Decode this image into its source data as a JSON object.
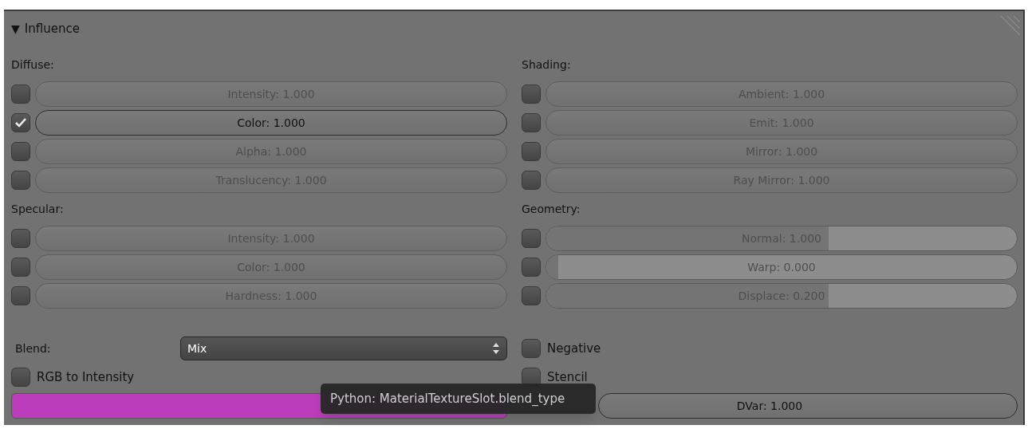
{
  "panel": {
    "toggle": "▼",
    "title": "Influence"
  },
  "left_groups": [
    {
      "label": "Diffuse:",
      "rows": [
        {
          "kind": "field",
          "label": "Intensity: 1.000",
          "checked": false
        },
        {
          "kind": "field",
          "label": "Color: 1.000",
          "checked": true
        },
        {
          "kind": "field",
          "label": "Alpha: 1.000",
          "checked": false
        },
        {
          "kind": "field",
          "label": "Translucency: 1.000",
          "checked": false
        }
      ]
    },
    {
      "label": "Specular:",
      "rows": [
        {
          "kind": "field",
          "label": "Intensity: 1.000",
          "checked": false
        },
        {
          "kind": "field",
          "label": "Color: 1.000",
          "checked": false
        },
        {
          "kind": "field",
          "label": "Hardness: 1.000",
          "checked": false
        }
      ]
    }
  ],
  "right_groups": [
    {
      "label": "Shading:",
      "rows": [
        {
          "kind": "field",
          "label": "Ambient: 1.000",
          "checked": false
        },
        {
          "kind": "field",
          "label": "Emit: 1.000",
          "checked": false
        },
        {
          "kind": "field",
          "label": "Mirror: 1.000",
          "checked": false
        },
        {
          "kind": "field",
          "label": "Ray Mirror: 1.000",
          "checked": false
        }
      ]
    },
    {
      "label": "Geometry:",
      "rows": [
        {
          "kind": "slider",
          "label": "Normal: 1.000",
          "checked": false,
          "level": 0.6
        },
        {
          "kind": "slider",
          "label": "Warp: 0.000",
          "checked": false,
          "level": 0
        },
        {
          "kind": "slider",
          "label": "Displace: 0.200",
          "checked": false,
          "level": 0.6
        }
      ]
    }
  ],
  "blend": {
    "label": "Blend:",
    "value": "Mix"
  },
  "left_options": [
    {
      "label": "RGB to Intensity",
      "checked": false
    }
  ],
  "right_options": [
    {
      "label": "Negative",
      "checked": false
    },
    {
      "label": "Stencil",
      "checked": false
    }
  ],
  "color_swatch": {
    "color": "#bb3dbb"
  },
  "dvar": {
    "label": "DVar: 1.000"
  },
  "tooltip": {
    "text": "Python: MaterialTextureSlot.blend_type"
  }
}
